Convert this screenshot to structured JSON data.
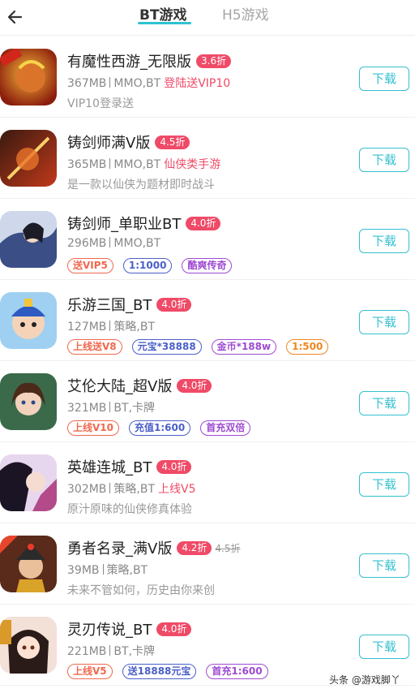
{
  "header": {
    "back_icon": "back-arrow-icon",
    "tabs": [
      {
        "label": "BT游戏",
        "active": true
      },
      {
        "label": "H5游戏",
        "active": false
      }
    ],
    "accent_color": "#2ec2d2"
  },
  "games": [
    {
      "title": "有魔性西游_无限版",
      "discount": "3.6折",
      "size": "367MB",
      "category": "MMO,BT",
      "highlight": "登陆送VIP10",
      "desc": "VIP10登录送",
      "button": "下载"
    },
    {
      "title": "铸剑师满V版",
      "discount": "4.5折",
      "size": "365MB",
      "category": "MMO,BT",
      "highlight": "仙侠类手游",
      "desc": "是一款以仙侠为题材即时战斗",
      "button": "下载"
    },
    {
      "title": "铸剑师_单职业BT",
      "discount": "4.0折",
      "size": "296MB",
      "category": "MMO,BT",
      "tags": [
        "送VIP5",
        "1:1000",
        "酷爽传奇"
      ],
      "button": "下载"
    },
    {
      "title": "乐游三国_BT",
      "discount": "4.0折",
      "size": "127MB",
      "category": "策略,BT",
      "tags": [
        "上线送V8",
        "元宝*38888",
        "金币*188w",
        "1:500"
      ],
      "button": "下载"
    },
    {
      "title": "艾伦大陆_超V版",
      "discount": "4.0折",
      "size": "321MB",
      "category": "BT,卡牌",
      "tags": [
        "上线V10",
        "充值1:600",
        "首充双倍"
      ],
      "button": "下载"
    },
    {
      "title": "英雄连城_BT",
      "discount": "4.0折",
      "size": "302MB",
      "category": "策略,BT",
      "highlight": "上线V5",
      "desc": "原汁原味的仙侠修真体验",
      "button": "下载"
    },
    {
      "title": "勇者名录_满V版",
      "discount": "4.2折",
      "original": "4.5折",
      "size": "39MB",
      "category": "策略,BT",
      "desc": "未来不管如何，历史由你来创",
      "button": "下载"
    },
    {
      "title": "灵刃传说_BT",
      "discount": "4.0折",
      "size": "221MB",
      "category": "BT,卡牌",
      "tags": [
        "上线V5",
        "送18888元宝",
        "首充1:600"
      ],
      "button": "下载"
    }
  ],
  "watermark": "头条 @游戏脚丫",
  "colors": {
    "discount_badge": "#ef4a67",
    "download_button": "#35c0cf",
    "tag_red": "#f0684e",
    "tag_blue": "#4a5fc8",
    "tag_purple": "#9e4ad2",
    "tag_orange": "#f2861f"
  }
}
